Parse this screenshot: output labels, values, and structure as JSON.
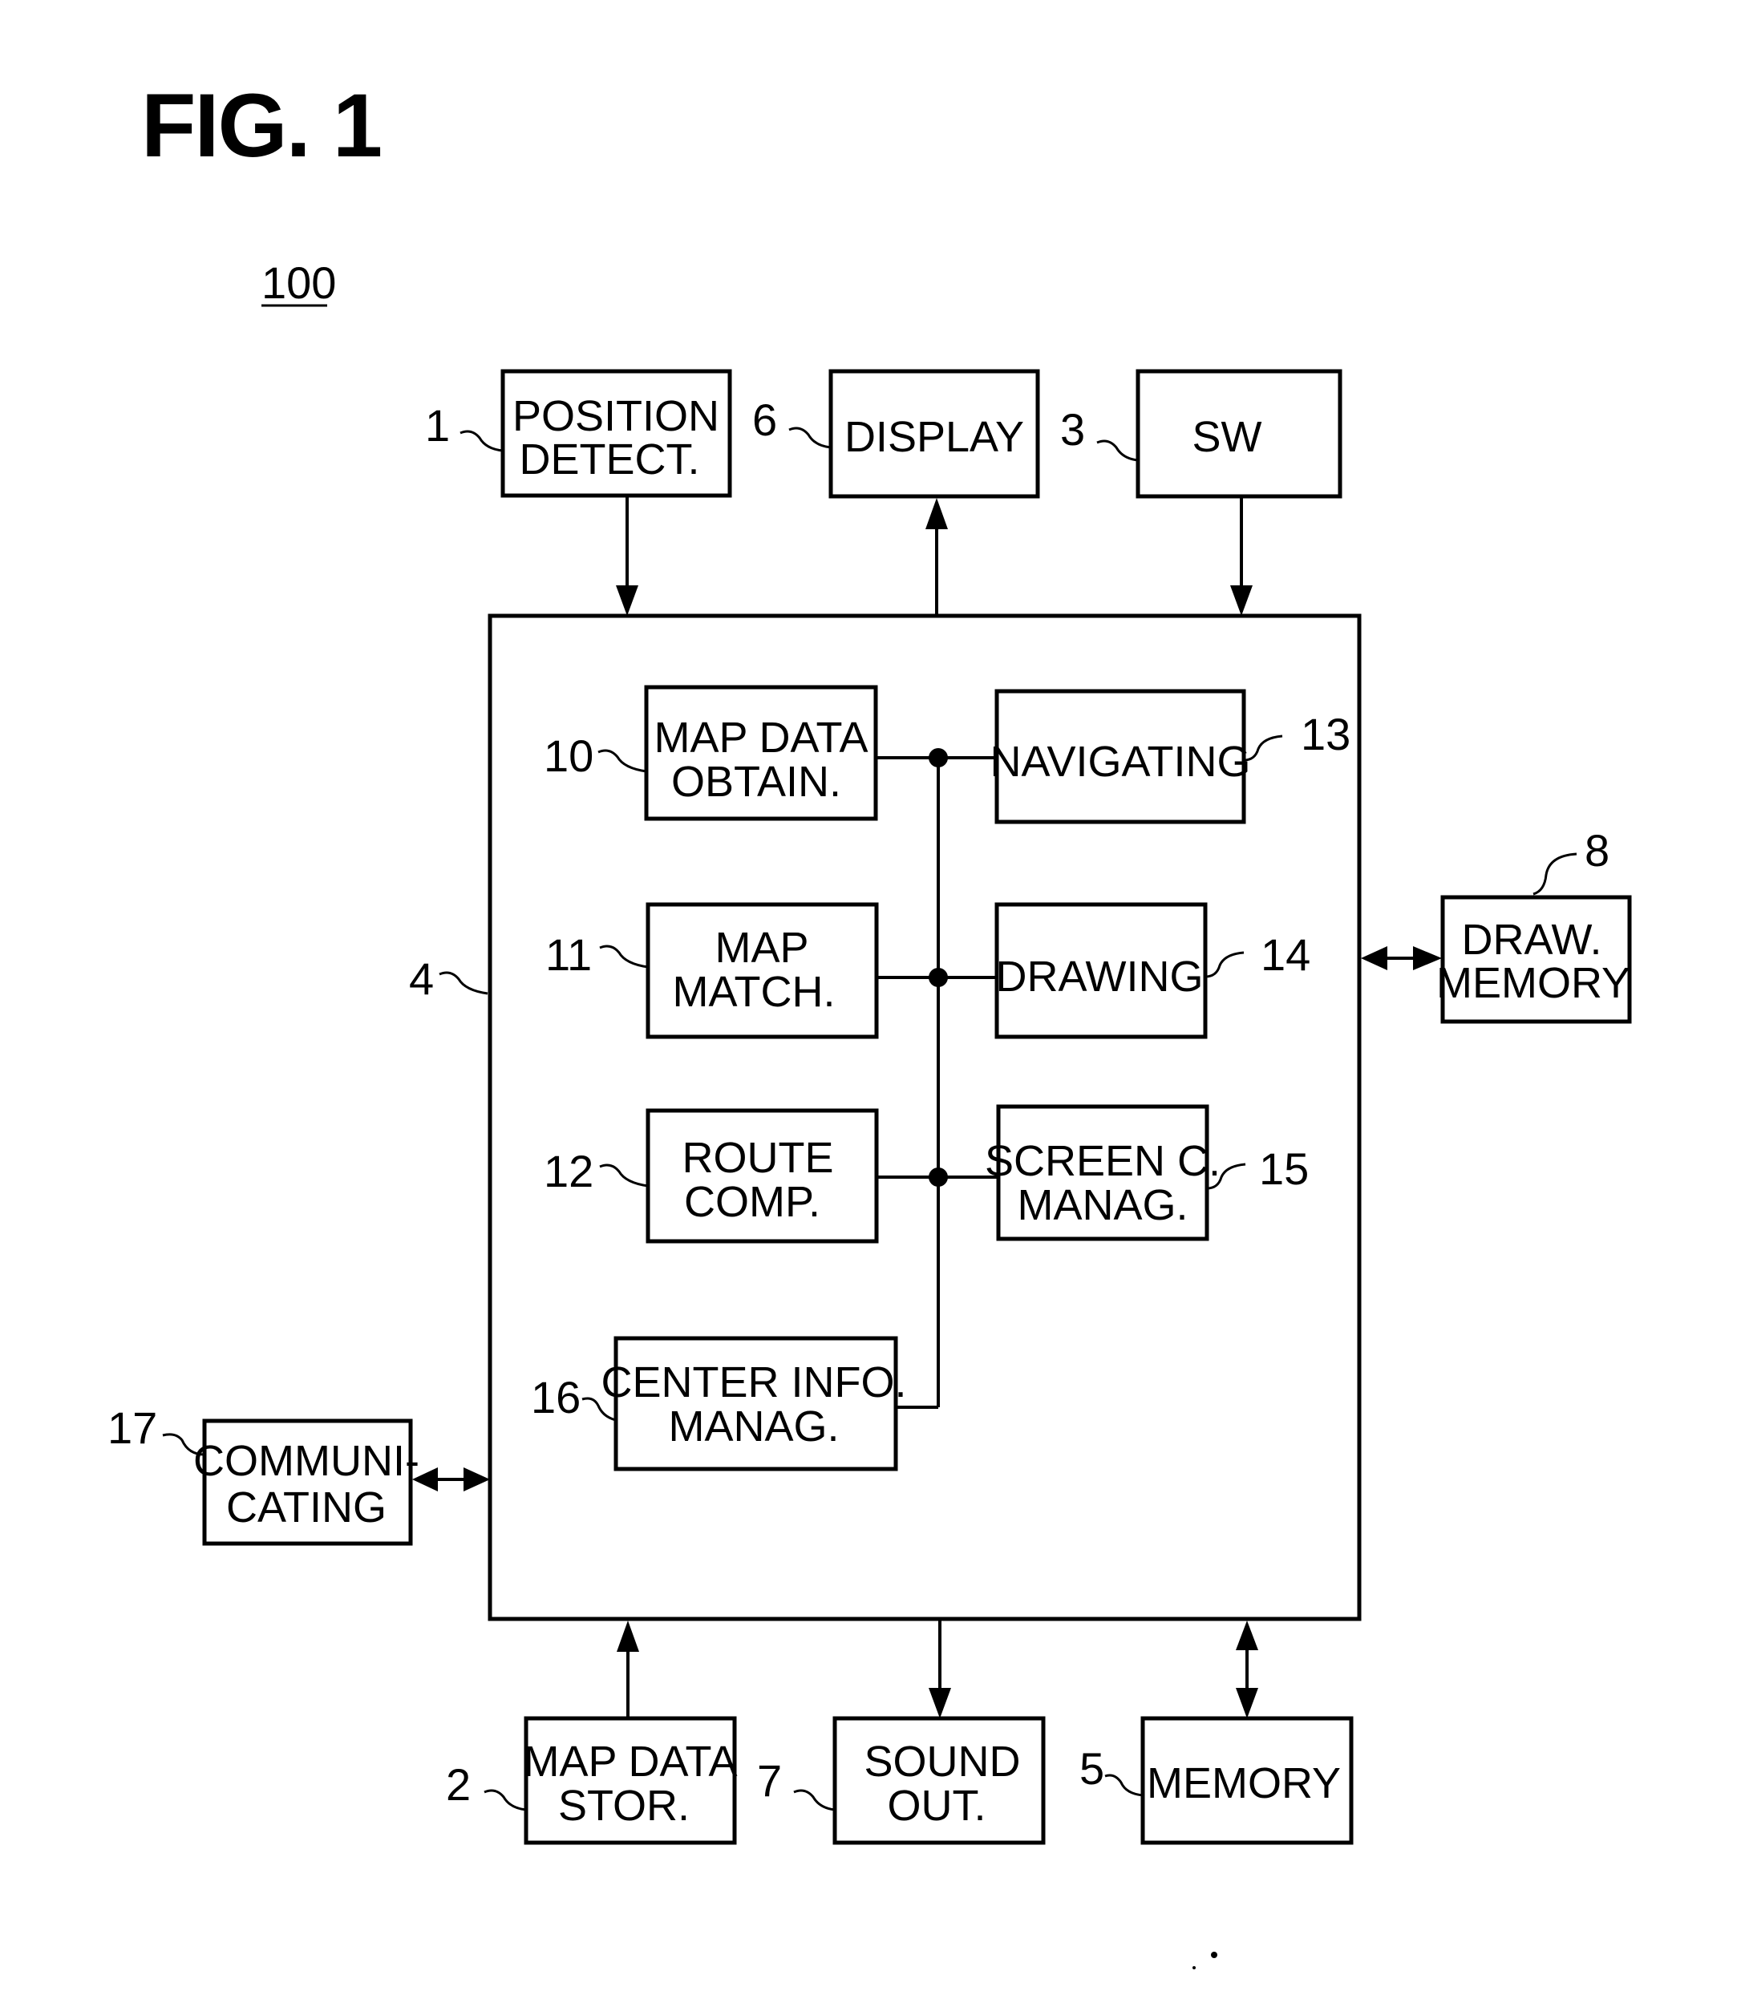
{
  "figure": {
    "title": "FIG. 1",
    "system_ref": "100"
  },
  "blocks": {
    "position_detect": {
      "ref": "1",
      "lines": [
        "POSITION",
        "DETECT."
      ]
    },
    "display": {
      "ref": "6",
      "lines": [
        "DISPLAY"
      ]
    },
    "sw": {
      "ref": "3",
      "lines": [
        "SW"
      ]
    },
    "controller": {
      "ref": "4"
    },
    "map_data_obtain": {
      "ref": "10",
      "lines": [
        "MAP DATA",
        "OBTAIN."
      ]
    },
    "navigating": {
      "ref": "13",
      "lines": [
        "NAVIGATING"
      ]
    },
    "map_match": {
      "ref": "11",
      "lines": [
        "MAP",
        "MATCH."
      ]
    },
    "drawing": {
      "ref": "14",
      "lines": [
        "DRAWING"
      ]
    },
    "route_comp": {
      "ref": "12",
      "lines": [
        "ROUTE",
        "COMP."
      ]
    },
    "screen_c_manag": {
      "ref": "15",
      "lines": [
        "SCREEN C.",
        "MANAG."
      ]
    },
    "center_info_manag": {
      "ref": "16",
      "lines": [
        "CENTER INFO.",
        "MANAG."
      ]
    },
    "draw_memory": {
      "ref": "8",
      "lines": [
        "DRAW.",
        "MEMORY"
      ]
    },
    "communicating": {
      "ref": "17",
      "lines": [
        "COMMUNI-",
        "CATING"
      ]
    },
    "map_data_stor": {
      "ref": "2",
      "lines": [
        "MAP DATA",
        "STOR."
      ]
    },
    "sound_out": {
      "ref": "7",
      "lines": [
        "SOUND",
        "OUT."
      ]
    },
    "memory": {
      "ref": "5",
      "lines": [
        "MEMORY"
      ]
    }
  },
  "connections": [
    {
      "from": "position_detect",
      "to": "controller",
      "direction": "one-way"
    },
    {
      "from": "controller",
      "to": "display",
      "direction": "one-way"
    },
    {
      "from": "sw",
      "to": "controller",
      "direction": "one-way"
    },
    {
      "from": "controller",
      "to": "draw_memory",
      "direction": "two-way"
    },
    {
      "from": "controller",
      "to": "communicating",
      "direction": "two-way"
    },
    {
      "from": "map_data_stor",
      "to": "controller",
      "direction": "one-way"
    },
    {
      "from": "controller",
      "to": "sound_out",
      "direction": "one-way"
    },
    {
      "from": "controller",
      "to": "memory",
      "direction": "two-way"
    },
    {
      "from": "map_data_obtain",
      "to": "internal_bus",
      "direction": "line"
    },
    {
      "from": "navigating",
      "to": "internal_bus",
      "direction": "line"
    },
    {
      "from": "map_match",
      "to": "internal_bus",
      "direction": "line"
    },
    {
      "from": "drawing",
      "to": "internal_bus",
      "direction": "line"
    },
    {
      "from": "route_comp",
      "to": "internal_bus",
      "direction": "line"
    },
    {
      "from": "screen_c_manag",
      "to": "internal_bus",
      "direction": "line"
    },
    {
      "from": "center_info_manag",
      "to": "internal_bus",
      "direction": "line"
    }
  ]
}
